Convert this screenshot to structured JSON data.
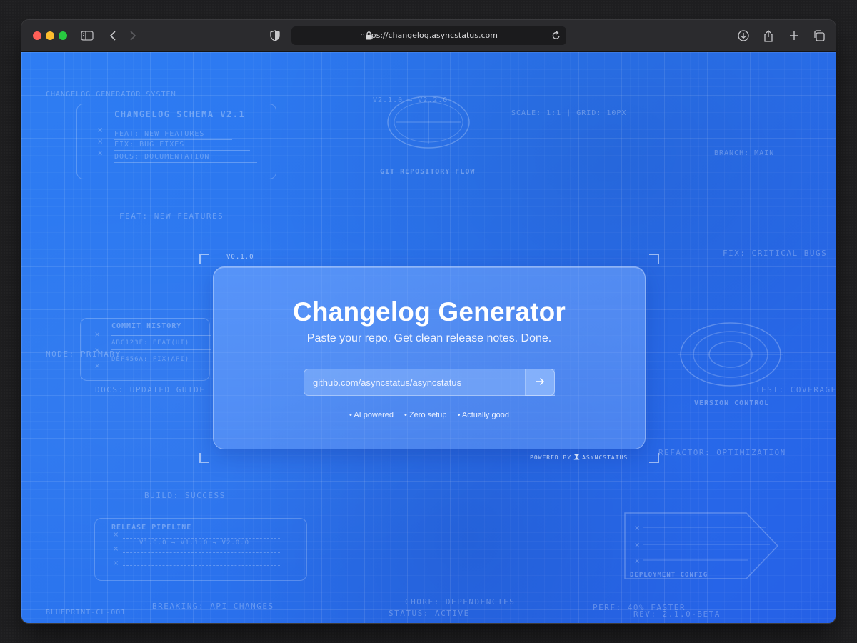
{
  "browser": {
    "url": "https://changelog.asyncstatus.com"
  },
  "hero": {
    "version": "V0.1.0",
    "title": "Changelog Generator",
    "subtitle": "Paste your repo. Get clean release notes. Done.",
    "input_value": "github.com/asyncstatus/asyncstatus",
    "features": [
      "• AI powered",
      "• Zero setup",
      "• Actually good"
    ],
    "powered_by": "POWERED BY",
    "brand": "ASYNCSTATUS"
  },
  "blueprint": {
    "system_label": "Changelog Generator System",
    "schema_title": "Changelog Schema v2.1",
    "schema_lines": [
      "feat: New Features",
      "fix: Bug Fixes",
      "docs: Documentation"
    ],
    "version_flow": "v2.1.0 → v2.2.0",
    "git_flow": "Git Repository Flow",
    "scale": "Scale: 1:1 | Grid: 10px",
    "branch": "Branch: main",
    "feat_new": "feat: New Features",
    "fix_critical": "fix: Critical Bugs",
    "commit_history": "Commit History",
    "commits": [
      "abc123f: feat(ui)",
      "def456a: fix(api)"
    ],
    "node_primary": "Node: Primary",
    "docs_updated": "docs: Updated Guide",
    "test_coverage": "test: Coverage",
    "version_control": "Version Control",
    "refactor": "refactor: Optimization",
    "build_success": "build: Success",
    "release_pipeline": "Release Pipeline",
    "pipeline_flow": "v1.0.0 → v1.1.0 → v2.0.0",
    "deployment_config": "Deployment Config",
    "chore": "chore: Dependencies",
    "status": "Status: Active",
    "perf": "perf: 40% Faster",
    "rev": "Rev: 2.1.0-beta",
    "breaking": "Breaking: API Changes",
    "blueprint_id": "Blueprint-CL-001"
  }
}
